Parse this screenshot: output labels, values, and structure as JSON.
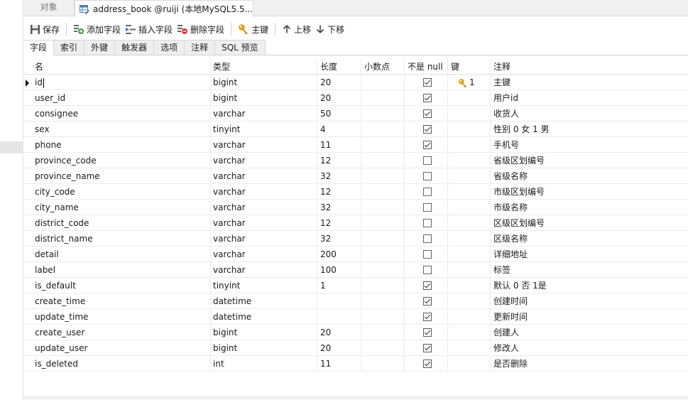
{
  "tabs": {
    "objects_label": "对象",
    "doc_title": "address_book @ruiji (本地MySQL5.5..."
  },
  "toolbar": {
    "save": "保存",
    "add_field": "添加字段",
    "insert_field": "插入字段",
    "delete_field": "删除字段",
    "primary_key": "主键",
    "move_up": "上移",
    "move_down": "下移"
  },
  "subtabs": [
    "字段",
    "索引",
    "外键",
    "触发器",
    "选项",
    "注释",
    "SQL 预览"
  ],
  "grid": {
    "headers": {
      "name": "名",
      "type": "类型",
      "length": "长度",
      "decimals": "小数点",
      "not_null": "不是 null",
      "key": "键",
      "comment": "注释"
    },
    "rows": [
      {
        "name": "id",
        "type": "bigint",
        "length": "20",
        "decimals": "",
        "not_null": true,
        "key": "1",
        "comment": "主键"
      },
      {
        "name": "user_id",
        "type": "bigint",
        "length": "20",
        "decimals": "",
        "not_null": true,
        "key": "",
        "comment": "用户id"
      },
      {
        "name": "consignee",
        "type": "varchar",
        "length": "50",
        "decimals": "",
        "not_null": true,
        "key": "",
        "comment": "收货人"
      },
      {
        "name": "sex",
        "type": "tinyint",
        "length": "4",
        "decimals": "",
        "not_null": true,
        "key": "",
        "comment": "性别 0 女 1 男"
      },
      {
        "name": "phone",
        "type": "varchar",
        "length": "11",
        "decimals": "",
        "not_null": true,
        "key": "",
        "comment": "手机号"
      },
      {
        "name": "province_code",
        "type": "varchar",
        "length": "12",
        "decimals": "",
        "not_null": false,
        "key": "",
        "comment": "省级区划编号"
      },
      {
        "name": "province_name",
        "type": "varchar",
        "length": "32",
        "decimals": "",
        "not_null": false,
        "key": "",
        "comment": "省级名称"
      },
      {
        "name": "city_code",
        "type": "varchar",
        "length": "12",
        "decimals": "",
        "not_null": false,
        "key": "",
        "comment": "市级区划编号"
      },
      {
        "name": "city_name",
        "type": "varchar",
        "length": "32",
        "decimals": "",
        "not_null": false,
        "key": "",
        "comment": "市级名称"
      },
      {
        "name": "district_code",
        "type": "varchar",
        "length": "12",
        "decimals": "",
        "not_null": false,
        "key": "",
        "comment": "区级区划编号"
      },
      {
        "name": "district_name",
        "type": "varchar",
        "length": "32",
        "decimals": "",
        "not_null": false,
        "key": "",
        "comment": "区级名称"
      },
      {
        "name": "detail",
        "type": "varchar",
        "length": "200",
        "decimals": "",
        "not_null": false,
        "key": "",
        "comment": "详细地址"
      },
      {
        "name": "label",
        "type": "varchar",
        "length": "100",
        "decimals": "",
        "not_null": false,
        "key": "",
        "comment": "标签"
      },
      {
        "name": "is_default",
        "type": "tinyint",
        "length": "1",
        "decimals": "",
        "not_null": true,
        "key": "",
        "comment": "默认 0 否 1是"
      },
      {
        "name": "create_time",
        "type": "datetime",
        "length": "",
        "decimals": "",
        "not_null": true,
        "key": "",
        "comment": "创建时间"
      },
      {
        "name": "update_time",
        "type": "datetime",
        "length": "",
        "decimals": "",
        "not_null": true,
        "key": "",
        "comment": "更新时间"
      },
      {
        "name": "create_user",
        "type": "bigint",
        "length": "20",
        "decimals": "",
        "not_null": true,
        "key": "",
        "comment": "创建人"
      },
      {
        "name": "update_user",
        "type": "bigint",
        "length": "20",
        "decimals": "",
        "not_null": true,
        "key": "",
        "comment": "修改人"
      },
      {
        "name": "is_deleted",
        "type": "int",
        "length": "11",
        "decimals": "",
        "not_null": true,
        "key": "",
        "comment": "是否删除"
      }
    ]
  },
  "colors": {
    "key_icon": "#e0a21b",
    "add_icon": "#3c9a3c",
    "delete_icon": "#d9392b",
    "table_icon": "#4a7fc1"
  },
  "icons": {
    "save": "save-icon",
    "add_field": "add-field-icon",
    "insert_field": "insert-field-icon",
    "delete_field": "delete-field-icon",
    "primary_key": "key-icon",
    "move_up": "arrow-up-icon",
    "move_down": "arrow-down-icon",
    "row_selected": "row-pointer-icon"
  }
}
